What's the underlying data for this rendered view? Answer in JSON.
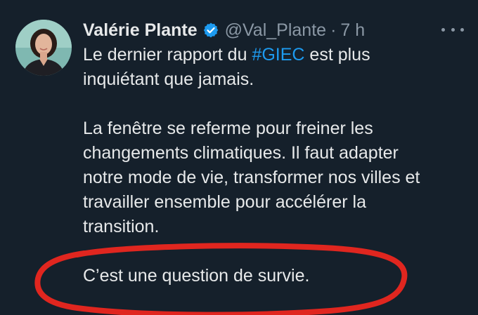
{
  "author": {
    "name": "Valérie Plante",
    "handle": "@Val_Plante",
    "separator": "·",
    "time": "7 h"
  },
  "icons": {
    "verified": "verified-badge-icon",
    "more": "more-options-icon",
    "avatar": "profile-photo"
  },
  "tweet": {
    "p1_line1_before": "Le dernier rapport du ",
    "p1_hashtag": "#GIEC",
    "p1_line1_after": " est plus",
    "p1_line2": "inquiétant que jamais.",
    "p2_line1": "La fenêtre se referme pour freiner les",
    "p2_line2": "changements climatiques. Il faut adapter",
    "p2_line3": "notre mode de vie, transformer nos villes et",
    "p2_line4": "travailler ensemble pour accélérer la",
    "p2_line5": "transition.",
    "p3_line1": "C’est une question de survie."
  },
  "colors": {
    "background": "#15202b",
    "text": "#e7e9ea",
    "muted": "#8b98a5",
    "link": "#1d9bf0",
    "verified": "#1d9bf0",
    "annotation": "#e0261f"
  }
}
